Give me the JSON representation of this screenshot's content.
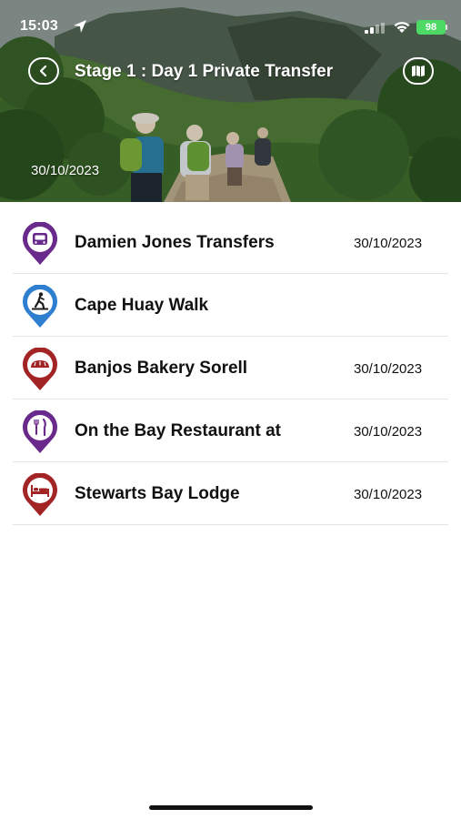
{
  "status_bar": {
    "time": "15:03",
    "battery": "98"
  },
  "header": {
    "title": "Stage 1 : Day 1 Private Transfer",
    "date": "30/10/2023",
    "back_icon": "chevron-left-icon",
    "map_icon": "map-icon"
  },
  "items": [
    {
      "title": "Damien Jones Transfers",
      "date": "30/10/2023",
      "icon": "bus-icon",
      "color": "#6a2a8c"
    },
    {
      "title": "Cape Huay Walk",
      "date": "",
      "icon": "hiker-icon",
      "color": "#2f7fd0"
    },
    {
      "title": "Banjos Bakery Sorell",
      "date": "30/10/2023",
      "icon": "bread-icon",
      "color": "#a32424"
    },
    {
      "title": "On the Bay Restaurant at",
      "date": "30/10/2023",
      "icon": "cutlery-icon",
      "color": "#6a2a8c"
    },
    {
      "title": "Stewarts Bay Lodge",
      "date": "30/10/2023",
      "icon": "bed-icon",
      "color": "#a32424"
    }
  ]
}
